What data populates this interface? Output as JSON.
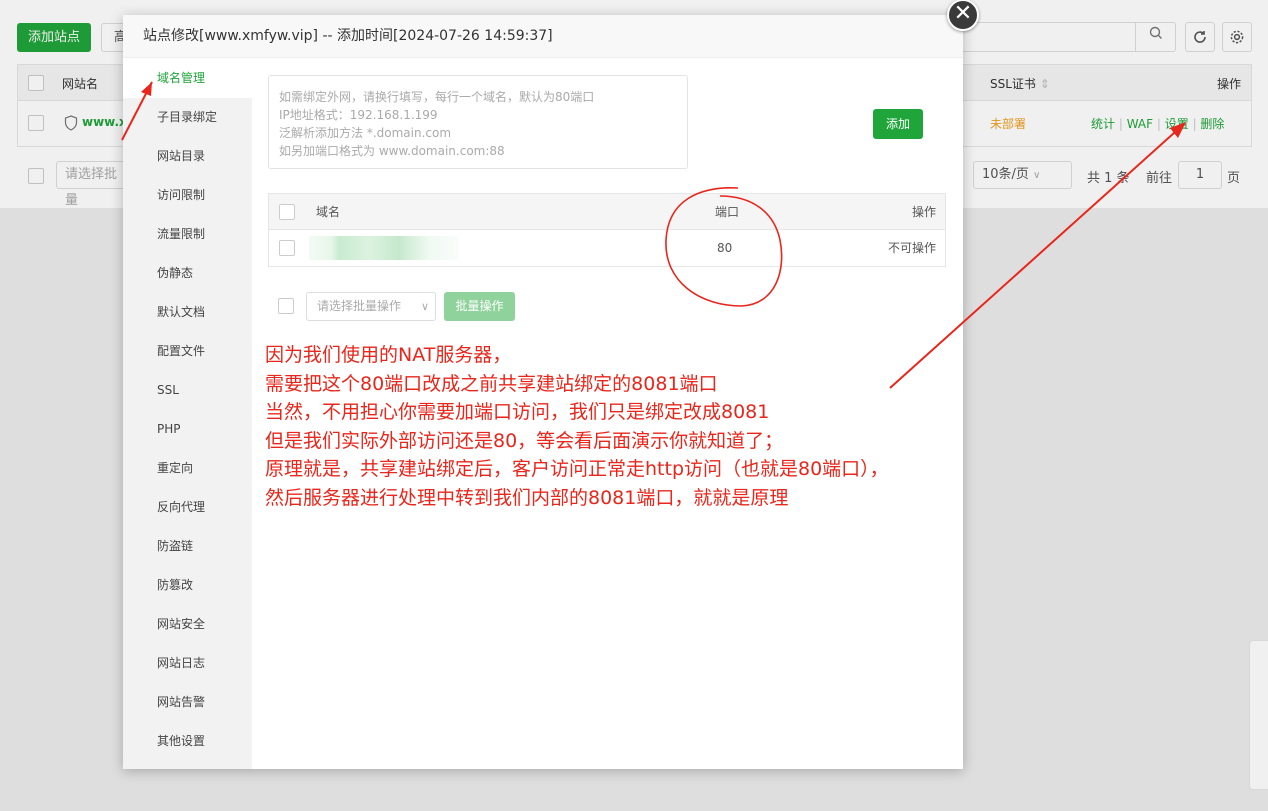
{
  "background": {
    "add_site_label": "添加站点",
    "second_btn_label": "高",
    "search_icon": "search-icon",
    "table_header": {
      "site_name": "网站名",
      "ssl": "SSL证书",
      "ops": "操作"
    },
    "row": {
      "site": "www.xm",
      "ssl_status": "未部署",
      "actions": [
        "统计",
        "WAF",
        "设置",
        "删除"
      ]
    },
    "batch_placeholder": "请选择批量",
    "pager": {
      "page_size": "10条/页",
      "total": "共 1 条",
      "goto": "前往",
      "page": "1",
      "page_unit": "页"
    }
  },
  "modal": {
    "title": "站点修改[www.xmfyw.vip] -- 添加时间[2024-07-26 14:59:37]",
    "sidebar": [
      {
        "label": "域名管理",
        "active": true
      },
      {
        "label": "子目录绑定"
      },
      {
        "label": "网站目录"
      },
      {
        "label": "访问限制"
      },
      {
        "label": "流量限制"
      },
      {
        "label": "伪静态"
      },
      {
        "label": "默认文档"
      },
      {
        "label": "配置文件"
      },
      {
        "label": "SSL"
      },
      {
        "label": "PHP"
      },
      {
        "label": "重定向"
      },
      {
        "label": "反向代理"
      },
      {
        "label": "防盗链"
      },
      {
        "label": "防篡改"
      },
      {
        "label": "网站安全"
      },
      {
        "label": "网站日志"
      },
      {
        "label": "网站告警"
      },
      {
        "label": "其他设置"
      }
    ],
    "domain_input": {
      "placeholder_lines": [
        "如需绑定外网，请换行填写，每行一个域名，默认为80端口",
        "IP地址格式：192.168.1.199",
        "泛解析添加方法 *.domain.com",
        "如另加端口格式为 www.domain.com:88"
      ]
    },
    "add_button": "添加",
    "table": {
      "headers": {
        "domain": "域名",
        "port": "端口",
        "ops": "操作"
      },
      "rows": [
        {
          "domain": "",
          "port": "80",
          "ops": "不可操作"
        }
      ]
    },
    "batch_select_placeholder": "请选择批量操作",
    "batch_button": "批量操作"
  },
  "annotation": {
    "color": "#e8261b",
    "lines": [
      "因为我们使用的NAT服务器，",
      "需要把这个80端口改成之前共享建站绑定的8081端口",
      "当然，不用担心你需要加端口访问，我们只是绑定改成8081",
      "但是我们实际外部访问还是80，等会看后面演示你就知道了；",
      "原理就是，共享建站绑定后，客户访问正常走http访问（也就是80端口），",
      "然后服务器进行处理中转到我们内部的8081端口，就就是原理"
    ]
  },
  "colors": {
    "brand_green": "#20a53a",
    "batch_disabled_green": "#8fd29b",
    "ssl_status_orange": "#f0a020"
  }
}
